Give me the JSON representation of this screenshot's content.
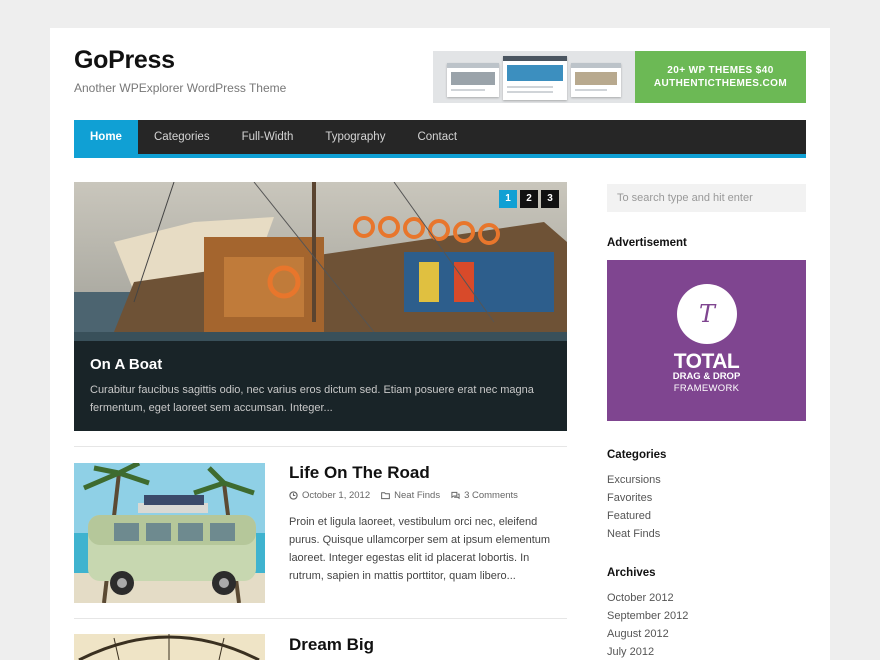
{
  "site": {
    "title": "GoPress",
    "description": "Another WPExplorer WordPress Theme"
  },
  "banner": {
    "line1": "20+ WP THEMES $40",
    "line2": "AUTHENTICTHEMES.COM",
    "color": "#6cb955"
  },
  "nav": {
    "items": [
      {
        "label": "Home",
        "active": true
      },
      {
        "label": "Categories",
        "active": false
      },
      {
        "label": "Full-Width",
        "active": false
      },
      {
        "label": "Typography",
        "active": false
      },
      {
        "label": "Contact",
        "active": false
      }
    ],
    "accent": "#10a0d4"
  },
  "slider": {
    "pages": [
      "1",
      "2",
      "3"
    ],
    "active_page": "1",
    "title": "On A Boat",
    "excerpt_line1": "Curabitur faucibus sagittis odio, nec varius eros dictum sed. Etiam posuere erat nec magna",
    "excerpt_line2": "fermentum, eget laoreet sem accumsan. Integer..."
  },
  "posts": [
    {
      "title": "Life On The Road",
      "date": "October 1, 2012",
      "category": "Neat Finds",
      "comments": "3 Comments",
      "excerpt_lines": [
        "Proin et ligula laoreet, vestibulum orci nec, eleifend",
        "purus. Quisque ullamcorper sem at ipsum elementum",
        "laoreet. Integer egestas elit id placerat lobortis. In",
        "rutrum, sapien in mattis porttitor, quam libero..."
      ]
    },
    {
      "title": "Dream Big"
    }
  ],
  "sidebar": {
    "search_placeholder": "To search type and hit enter",
    "ad_title": "Advertisement",
    "ad": {
      "letter": "T",
      "line1": "TOTAL",
      "line2": "DRAG & DROP",
      "line3": "FRAMEWORK",
      "color": "#7f4590"
    },
    "categories_title": "Categories",
    "categories": [
      "Excursions",
      "Favorites",
      "Featured",
      "Neat Finds"
    ],
    "archives_title": "Archives",
    "archives": [
      "October 2012",
      "September 2012",
      "August 2012",
      "July 2012"
    ]
  }
}
